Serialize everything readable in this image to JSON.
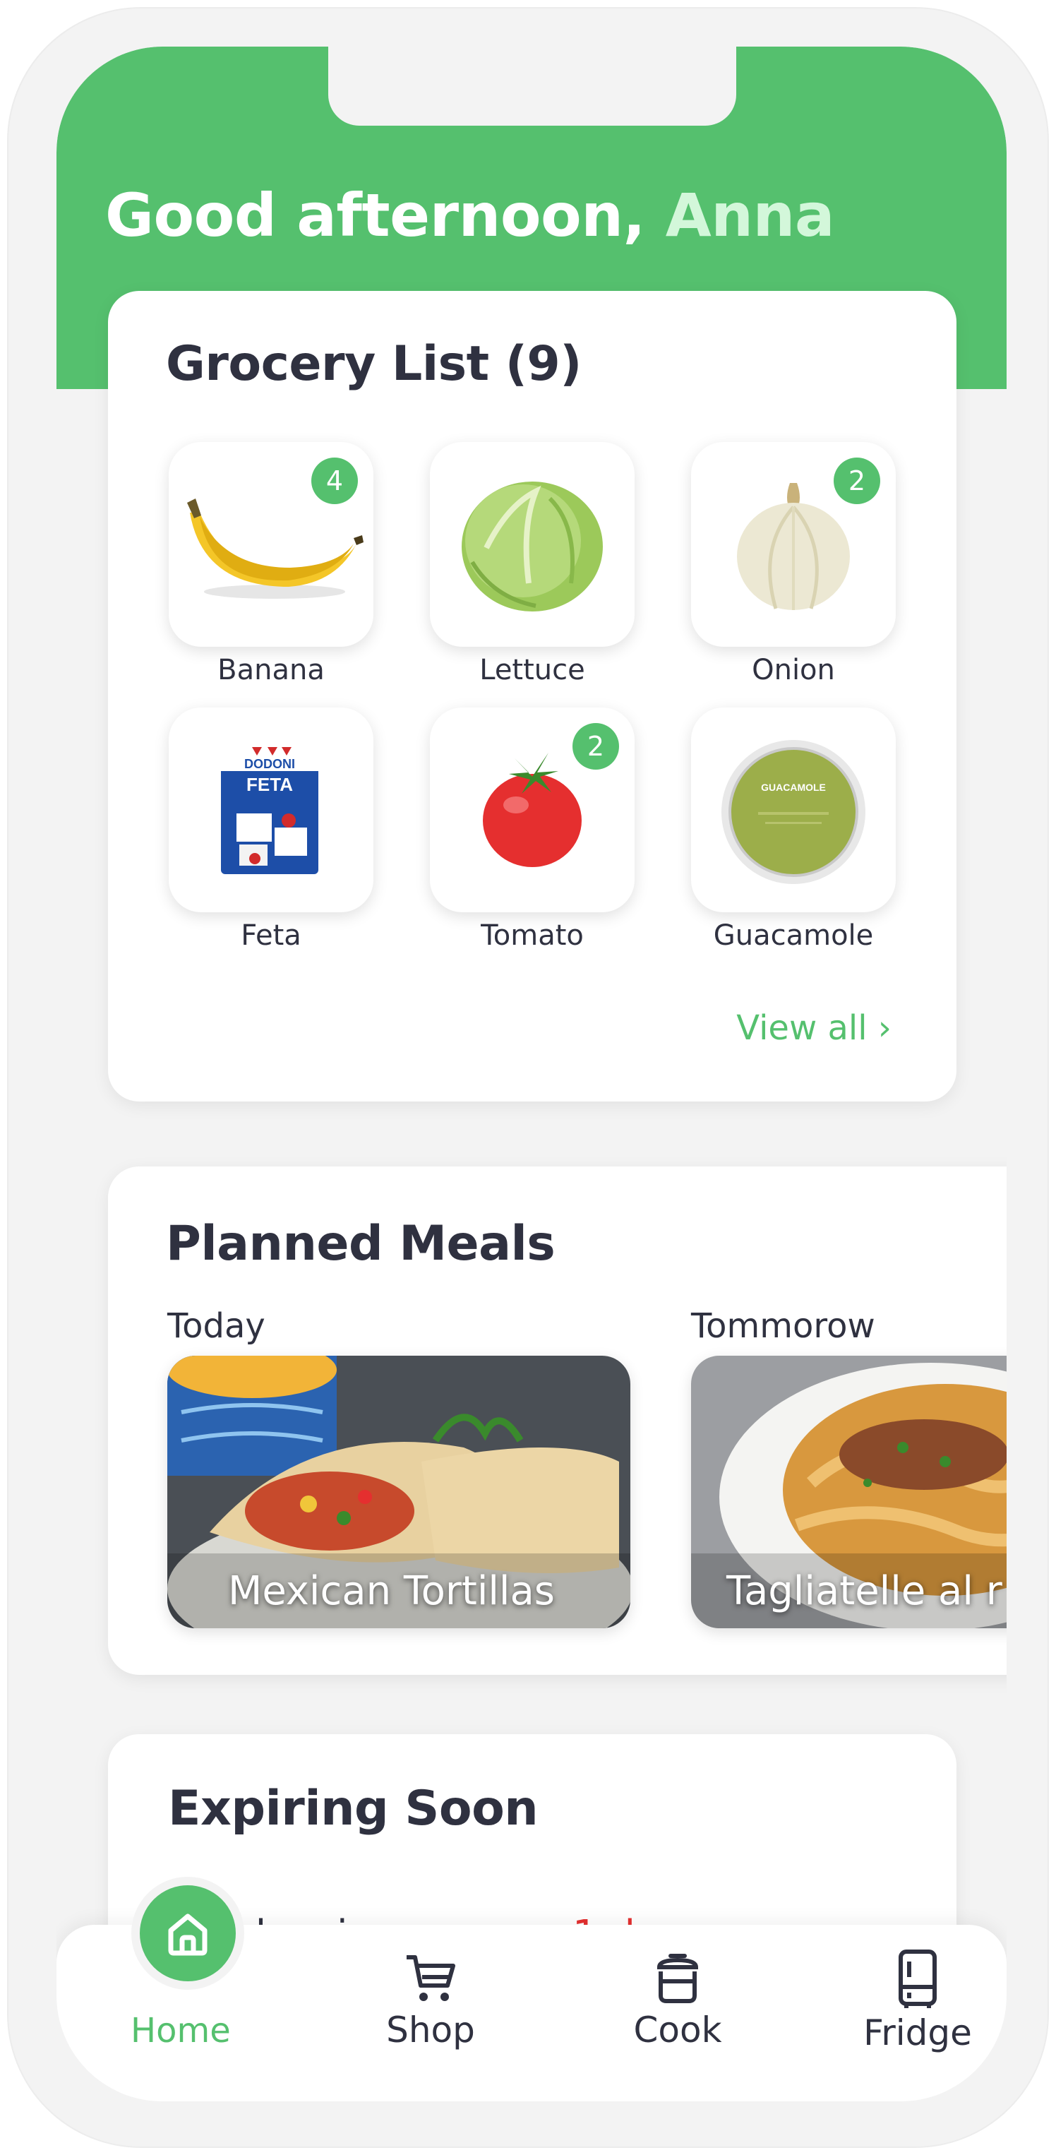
{
  "header": {
    "greeting_prefix": "Good afternoon,",
    "user_name": "Anna"
  },
  "grocery": {
    "title": "Grocery List (9)",
    "items": [
      {
        "label": "Banana",
        "count": "4",
        "icon": "banana-icon"
      },
      {
        "label": "Lettuce",
        "count": "",
        "icon": "lettuce-icon"
      },
      {
        "label": "Onion",
        "count": "2",
        "icon": "onion-icon"
      },
      {
        "label": "Feta",
        "count": "",
        "icon": "feta-icon"
      },
      {
        "label": "Tomato",
        "count": "2",
        "icon": "tomato-icon"
      },
      {
        "label": "Guacamole",
        "count": "",
        "icon": "guacamole-icon"
      }
    ],
    "feta_brand": "DODONI",
    "feta_name": "FETA",
    "guac_label": "GUACAMOLE",
    "view_all": "View all ›"
  },
  "meals": {
    "title": "Planned Meals",
    "items": [
      {
        "day": "Today",
        "name": "Mexican Tortillas"
      },
      {
        "day": "Tommorow",
        "name": "Tagliatelle al r"
      }
    ]
  },
  "expiring": {
    "title": "Expiring Soon",
    "items": [
      {
        "name": "Blueberries",
        "days": "1 day"
      }
    ]
  },
  "nav": {
    "items": [
      {
        "label": "Home",
        "icon": "home-icon",
        "active": true
      },
      {
        "label": "Shop",
        "icon": "cart-icon"
      },
      {
        "label": "Cook",
        "icon": "pot-icon"
      },
      {
        "label": "Fridge",
        "icon": "fridge-icon"
      }
    ]
  },
  "colors": {
    "accent": "#55c06e",
    "accent_light": "#d3f7da",
    "warning": "#e53030",
    "text": "#2f3140",
    "background": "#f3f3f3"
  }
}
